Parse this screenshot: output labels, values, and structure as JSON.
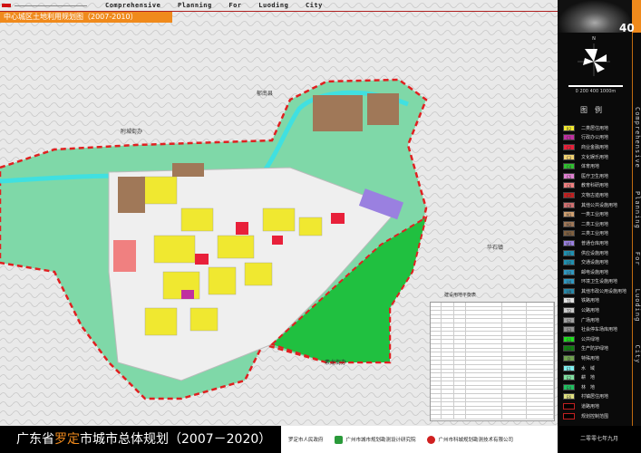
{
  "header": {
    "slogan": "Comprehensive Planning For Luoding City",
    "subtitle": "中心城区土地利用规划图（2007-2010）",
    "page_number": "40"
  },
  "map": {
    "places": [
      {
        "name": "附城街办"
      },
      {
        "name": "郁南县"
      },
      {
        "name": "华石镇"
      },
      {
        "name": "素龙街办"
      }
    ],
    "table_title": "建设用地平衡表",
    "colors": {
      "residential": "#f0e830",
      "commercial": "#e8203a",
      "admin": "#c030a0",
      "green": "#20c040",
      "protective": "#7fd8a8",
      "industrial": "#a07858",
      "water": "#40e0e0",
      "boundary": "#e02020",
      "storage": "#9a80e0"
    }
  },
  "sidebar": {
    "compass": "N",
    "scale": "0 200 400      1000m",
    "legend_title": "图例",
    "legend": [
      {
        "code": "R2",
        "label": "二类居住用地",
        "color": "#f0e830"
      },
      {
        "code": "C1",
        "label": "行政办公用地",
        "color": "#c030a0"
      },
      {
        "code": "C2",
        "label": "商业金融用地",
        "color": "#e8203a"
      },
      {
        "code": "C3",
        "label": "文化娱乐用地",
        "color": "#f0d070"
      },
      {
        "code": "C4",
        "label": "体育用地",
        "color": "#30c030"
      },
      {
        "code": "C5",
        "label": "医疗卫生用地",
        "color": "#e080d0"
      },
      {
        "code": "C6",
        "label": "教育科研用地",
        "color": "#f08080"
      },
      {
        "code": "C7",
        "label": "文物古迹用地",
        "color": "#c02020"
      },
      {
        "code": "C9",
        "label": "其他公共设施用地",
        "color": "#d07070"
      },
      {
        "code": "M1",
        "label": "一类工业用地",
        "color": "#d0a070"
      },
      {
        "code": "M2",
        "label": "二类工业用地",
        "color": "#a07858"
      },
      {
        "code": "M3",
        "label": "三类工业用地",
        "color": "#806040"
      },
      {
        "code": "W1",
        "label": "普通仓库用地",
        "color": "#9a80e0"
      },
      {
        "code": "U1",
        "label": "供应设施用地",
        "color": "#2090b0"
      },
      {
        "code": "U2",
        "label": "交通设施用地",
        "color": "#2090b0"
      },
      {
        "code": "U3",
        "label": "邮电设施用地",
        "color": "#3098c0"
      },
      {
        "code": "U4",
        "label": "环境卫生设施用地",
        "color": "#3098c0"
      },
      {
        "code": "U9",
        "label": "其他市政公用设施用地",
        "color": "#2888a8"
      },
      {
        "code": "T1",
        "label": "铁路用地",
        "color": "#e0e0e0"
      },
      {
        "code": "T2",
        "label": "公路用地",
        "color": "#c8c8c8"
      },
      {
        "code": "S2",
        "label": "广场用地",
        "color": "#a0a0a0"
      },
      {
        "code": "S3",
        "label": "社会停车场库用地",
        "color": "#909090"
      },
      {
        "code": "G1",
        "label": "公共绿地",
        "color": "#20e020"
      },
      {
        "code": "G2",
        "label": "生产防护绿地",
        "color": "#108010"
      },
      {
        "code": "D",
        "label": "特殊用地",
        "color": "#70a050"
      },
      {
        "code": "E1",
        "label": "水　域",
        "color": "#80f0f0"
      },
      {
        "code": "E2",
        "label": "耕　地",
        "color": "#80e0a0"
      },
      {
        "code": "E4",
        "label": "林　地",
        "color": "#20c060"
      },
      {
        "code": "E6",
        "label": "村镇居住用地",
        "color": "#e0e080"
      },
      {
        "code": "",
        "label": "道路用地",
        "color": "#000000"
      },
      {
        "code": "",
        "label": "规划控制范围",
        "color": "#000000"
      }
    ]
  },
  "footer": {
    "title_pre": "广东省",
    "title_hl": "罗定",
    "title_post": "市城市总体规划（2007－2020）",
    "org1": "罗定市人民政府",
    "org2": "广州市城市规划勘测设计研究院",
    "org3": "广州市科城规划勘测技术有限公司",
    "date": "二零零七年九月"
  }
}
